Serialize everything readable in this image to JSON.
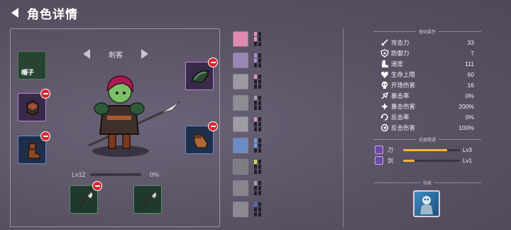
{
  "header": {
    "title": "角色详情"
  },
  "equipment": {
    "hat_label": "帽子",
    "class_name": "刺客",
    "level_label": "Lv12",
    "xp_percent_label": "0%",
    "xp_fraction": 0.0
  },
  "stats": {
    "section_title": "基础属性",
    "rows": [
      {
        "label": "攻击力",
        "value": "33",
        "icon": "sword-icon"
      },
      {
        "label": "防御力",
        "value": "7",
        "icon": "shield-icon"
      },
      {
        "label": "速度",
        "value": "111",
        "icon": "boot-icon"
      },
      {
        "label": "生命上限",
        "value": "60",
        "icon": "heart-icon"
      },
      {
        "label": "开场伤害",
        "value": "16",
        "icon": "skull-icon"
      },
      {
        "label": "暴击率",
        "value": "0%",
        "icon": "crit-icon"
      },
      {
        "label": "暴击伤害",
        "value": "200%",
        "icon": "crit-damage-icon"
      },
      {
        "label": "反击率",
        "value": "0%",
        "icon": "counter-icon"
      },
      {
        "label": "反击伤害",
        "value": "100%",
        "icon": "counter-damage-icon"
      }
    ]
  },
  "weapons": {
    "section_title": "武器精通",
    "rows": [
      {
        "name": "刀",
        "level": "Lv3",
        "fraction": 0.78
      },
      {
        "name": "剑",
        "level": "Lv1",
        "fraction": 0.2
      }
    ]
  },
  "skills": {
    "section_title": "技能"
  },
  "colors": {
    "background": "#5c5467",
    "remove_badge": "#d8262e",
    "progress_gold": "#f2b53e",
    "weapon_purple": "#6e49a6"
  }
}
